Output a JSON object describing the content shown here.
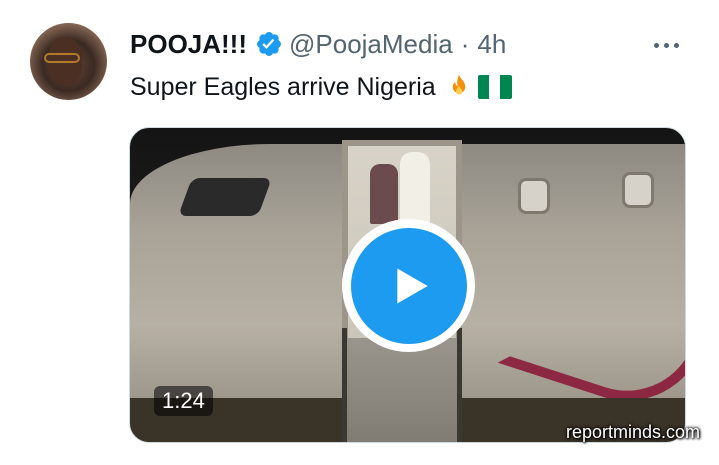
{
  "tweet": {
    "author_name": "POOJA!!!",
    "verified_icon": "verified-badge-icon",
    "handle": "@PoojaMedia",
    "separator": "·",
    "time": "4h",
    "text": "Super Eagles arrive Nigeria",
    "emojis": [
      "fire-icon",
      "nigeria-flag-icon"
    ]
  },
  "media": {
    "duration": "1:24",
    "play_icon": "play-icon"
  },
  "watermark": "reportminds.com",
  "colors": {
    "accent": "#1d9bf0",
    "secondary_text": "#536471",
    "primary_text": "#0f1419"
  }
}
